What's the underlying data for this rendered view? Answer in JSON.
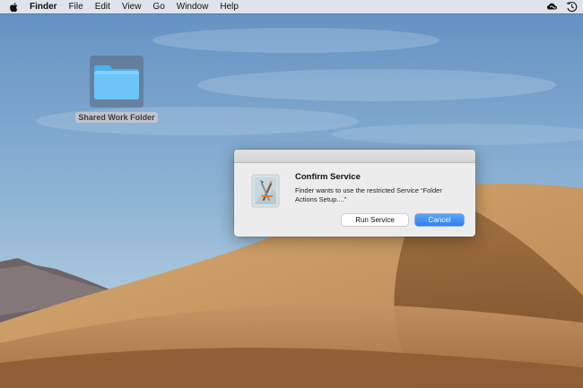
{
  "menubar": {
    "apple_icon": "apple-logo-icon",
    "app_name": "Finder",
    "items": [
      "File",
      "Edit",
      "View",
      "Go",
      "Window",
      "Help"
    ],
    "right_icons": [
      "creative-cloud-icon",
      "time-machine-icon"
    ]
  },
  "desktop": {
    "folder": {
      "icon": "folder-icon",
      "label": "Shared Work Folder",
      "selected": true,
      "color": "#6cc4f7"
    }
  },
  "dialog": {
    "title": "Confirm Service",
    "message": "Finder wants to use the restricted Service “Folder Actions Setup....”",
    "app_icon": "automator-script-icon",
    "buttons": {
      "secondary": "Run Service",
      "primary": "Cancel"
    },
    "accent_color": "#2f7ff1"
  }
}
